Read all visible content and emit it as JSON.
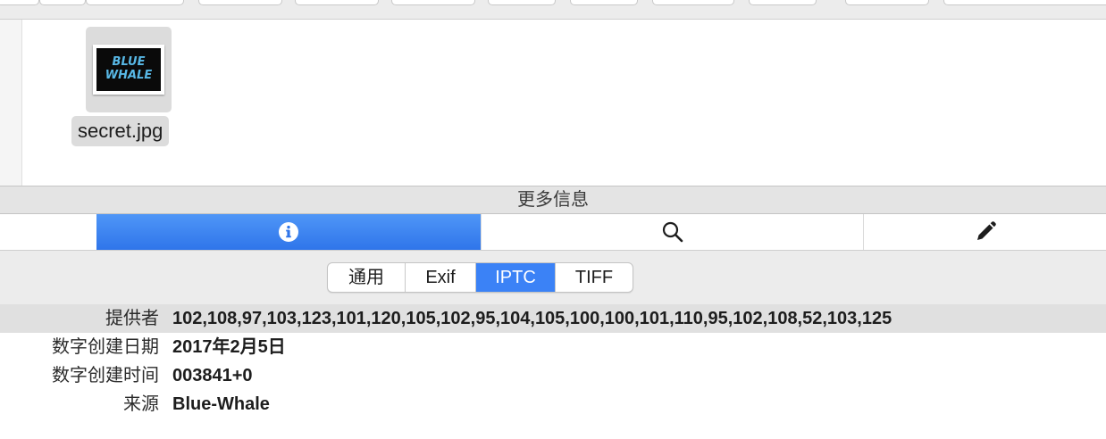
{
  "file": {
    "name": "secret.jpg",
    "thumbnail_text_line1": "BLUE",
    "thumbnail_text_line2": "WHALE"
  },
  "more_info": {
    "title": "更多信息"
  },
  "inspector_tabs": [
    {
      "icon": "info-icon",
      "active": true
    },
    {
      "icon": "search-icon",
      "active": false
    },
    {
      "icon": "pencil-icon",
      "active": false
    }
  ],
  "segments": [
    {
      "label": "通用",
      "active": false
    },
    {
      "label": "Exif",
      "active": false
    },
    {
      "label": "IPTC",
      "active": true
    },
    {
      "label": "TIFF",
      "active": false
    }
  ],
  "metadata": [
    {
      "label": "提供者",
      "value": "102,108,97,103,123,101,120,105,102,95,104,105,100,100,101,110,95,102,108,52,103,125"
    },
    {
      "label": "数字创建日期",
      "value": "2017年2月5日"
    },
    {
      "label": "数字创建时间",
      "value": "003841+0"
    },
    {
      "label": "来源",
      "value": "Blue-Whale"
    }
  ],
  "colors": {
    "accent": "#3b82f6",
    "thumbnail_text": "#58b8e6"
  }
}
